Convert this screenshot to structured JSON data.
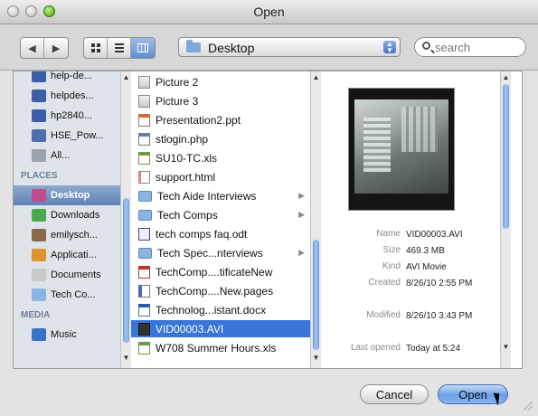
{
  "window": {
    "title": "Open"
  },
  "toolbar": {
    "location": "Desktop",
    "search_placeholder": "search"
  },
  "sidebar": {
    "devices": [
      {
        "label": "help-de...",
        "icon": "display-icon",
        "color": "#3a5fa6"
      },
      {
        "label": "helpdes...",
        "icon": "display-icon",
        "color": "#3a5fa6"
      },
      {
        "label": "hp2840...",
        "icon": "display-icon",
        "color": "#3a5fa6"
      },
      {
        "label": "HSE_Pow...",
        "icon": "network-computer-icon",
        "color": "#4d6fae"
      },
      {
        "label": "All...",
        "icon": "globe-icon",
        "color": "#9aa2ad"
      }
    ],
    "places_header": "PLACES",
    "places": [
      {
        "label": "Desktop",
        "icon": "desktop-icon",
        "color": "#c24b8c",
        "selected": true
      },
      {
        "label": "Downloads",
        "icon": "downloads-icon",
        "color": "#4aa94a"
      },
      {
        "label": "emilysch...",
        "icon": "home-icon",
        "color": "#8a6a4a"
      },
      {
        "label": "Applicati...",
        "icon": "applications-icon",
        "color": "#e0922c"
      },
      {
        "label": "Documents",
        "icon": "documents-icon",
        "color": "#c9c9c9"
      },
      {
        "label": "Tech Co...",
        "icon": "folder-icon",
        "color": "#8cb4e3"
      }
    ],
    "media_header": "MEDIA",
    "media": [
      {
        "label": "Music",
        "icon": "music-icon",
        "color": "#3b72c9"
      }
    ]
  },
  "files": [
    {
      "name": "Picture 2",
      "type": "img"
    },
    {
      "name": "Picture 3",
      "type": "img"
    },
    {
      "name": "Presentation2.ppt",
      "type": "ppt"
    },
    {
      "name": "stlogin.php",
      "type": "php"
    },
    {
      "name": "SU10-TC.xls",
      "type": "xls"
    },
    {
      "name": "support.html",
      "type": "html"
    },
    {
      "name": "Tech Aide Interviews",
      "type": "folder",
      "folder": true
    },
    {
      "name": "Tech Comps",
      "type": "folder",
      "folder": true
    },
    {
      "name": "tech comps faq.odt",
      "type": "odt"
    },
    {
      "name": "Tech Spec...nterviews",
      "type": "folder",
      "folder": true
    },
    {
      "name": "TechComp....tificateNew",
      "type": "pdf"
    },
    {
      "name": "TechComp....New.pages",
      "type": "pages"
    },
    {
      "name": "Technolog...istant.docx",
      "type": "docx"
    },
    {
      "name": "VID00003.AVI",
      "type": "movie",
      "selected": true
    },
    {
      "name": "W708 Summer Hours.xls",
      "type": "xls"
    }
  ],
  "preview": {
    "info": [
      {
        "key": "Name",
        "value": "VID00003.AVI"
      },
      {
        "key": "Size",
        "value": "469.3 MB"
      },
      {
        "key": "Kind",
        "value": "AVI Movie"
      },
      {
        "key": "Created",
        "value": "8/26/10 2:55 PM"
      },
      {
        "key": "Modified",
        "value": "8/26/10 3:43 PM"
      },
      {
        "key": "Last opened",
        "value": "Today at 5:24"
      }
    ]
  },
  "buttons": {
    "cancel": "Cancel",
    "open": "Open"
  }
}
